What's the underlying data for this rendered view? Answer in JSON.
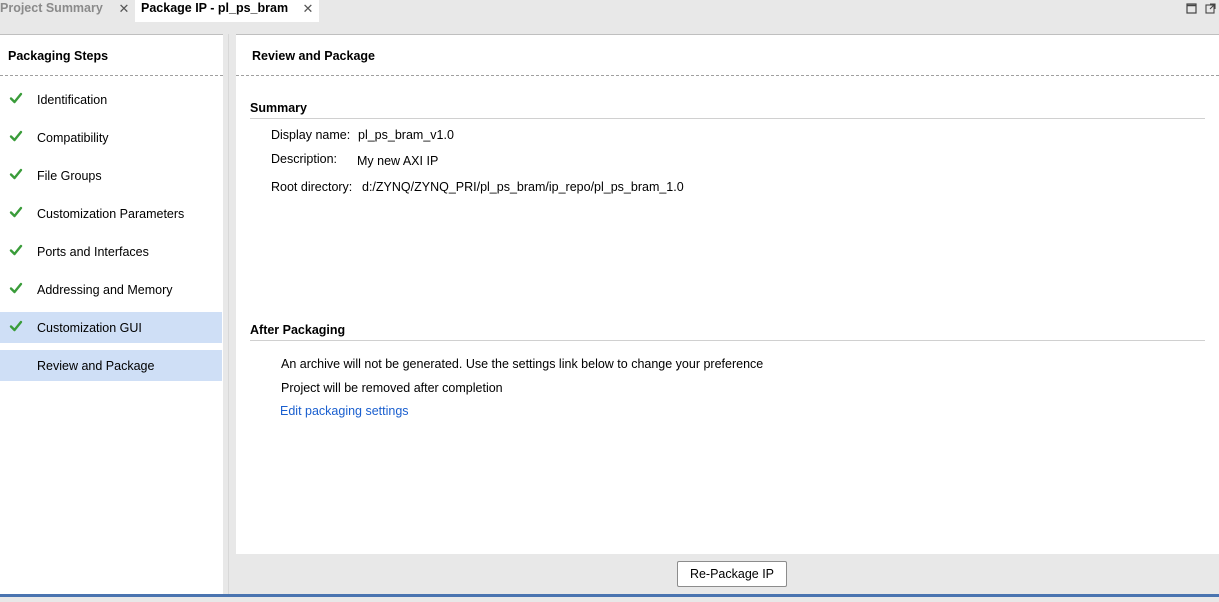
{
  "tabs": [
    {
      "label": "Project Summary",
      "close": "✕"
    },
    {
      "label": "Package IP - pl_ps_bram",
      "close": "✕"
    }
  ],
  "window_controls": {
    "maximize_icon": "maximize-icon",
    "restore_icon": "restore-icon"
  },
  "left_panel": {
    "header": "Packaging Steps",
    "check_color": "#3a9c3a",
    "selected_color": "#cfdff6",
    "steps": [
      {
        "label": "Identification",
        "status": "done"
      },
      {
        "label": "Compatibility",
        "status": "done"
      },
      {
        "label": "File Groups",
        "status": "done"
      },
      {
        "label": "Customization Parameters",
        "status": "done"
      },
      {
        "label": "Ports and Interfaces",
        "status": "done"
      },
      {
        "label": "Addressing and Memory",
        "status": "done"
      },
      {
        "label": "Customization GUI",
        "status": "done"
      },
      {
        "label": "Review and Package",
        "status": "current"
      }
    ]
  },
  "main": {
    "title": "Review and Package",
    "summary": {
      "title": "Summary",
      "display_name_label": "Display name:",
      "display_name_value": "pl_ps_bram_v1.0",
      "description_label": "Description:",
      "description_value": "My new AXI IP",
      "root_directory_label": "Root directory:",
      "root_directory_value": "d:/ZYNQ/ZYNQ_PRI/pl_ps_bram/ip_repo/pl_ps_bram_1.0"
    },
    "after_packaging": {
      "title": "After Packaging",
      "line1": "An archive will not be generated. Use the settings link below to change your preference",
      "line2": "Project will be removed after completion",
      "link": "Edit packaging settings",
      "link_color": "#1a5fcf"
    }
  },
  "footer": {
    "repackage_label": "Re-Package IP"
  }
}
